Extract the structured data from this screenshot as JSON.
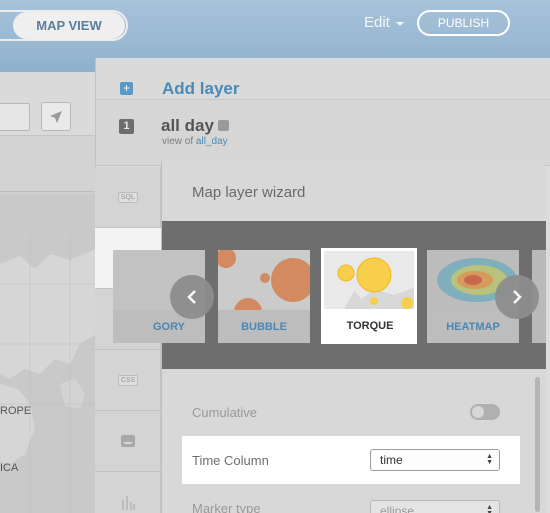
{
  "topbar": {
    "map_view_label": "MAP VIEW",
    "edit_label": "Edit",
    "publish_label": "PUBLISH"
  },
  "map": {
    "labels": [
      "ROPE",
      "ICA"
    ]
  },
  "layers": {
    "add_icon": "+",
    "add_layer_label": "Add layer",
    "layer_number": "1",
    "layer_name": "all day",
    "view_of_prefix": "view of",
    "view_of_table": "all_day"
  },
  "tabs": [
    {
      "name": "sql",
      "badge": "SQL"
    },
    {
      "name": "wizard",
      "icon": "paintbrush-icon"
    },
    {
      "name": "infowindow",
      "icon": "speech-bubble-icon"
    },
    {
      "name": "css",
      "badge": "CSS"
    },
    {
      "name": "legend",
      "icon": "legend-icon"
    },
    {
      "name": "filters",
      "icon": "bar-chart-icon"
    }
  ],
  "wizard": {
    "title": "Map layer wizard",
    "types": [
      {
        "label": "GORY"
      },
      {
        "label": "BUBBLE"
      },
      {
        "label": "TORQUE",
        "selected": true
      },
      {
        "label": "HEATMAP"
      }
    ],
    "options": {
      "cumulative_label": "Cumulative",
      "cumulative_on": false,
      "time_column_label": "Time Column",
      "time_column_value": "time",
      "marker_type_label": "Marker type",
      "marker_type_value": "ellipse"
    }
  },
  "colors": {
    "accent_blue": "#4a8ab8",
    "topbar": "#9dbbd4",
    "torque_yellow": "#f7cf4a",
    "bubble_orange": "#d88c5e"
  }
}
